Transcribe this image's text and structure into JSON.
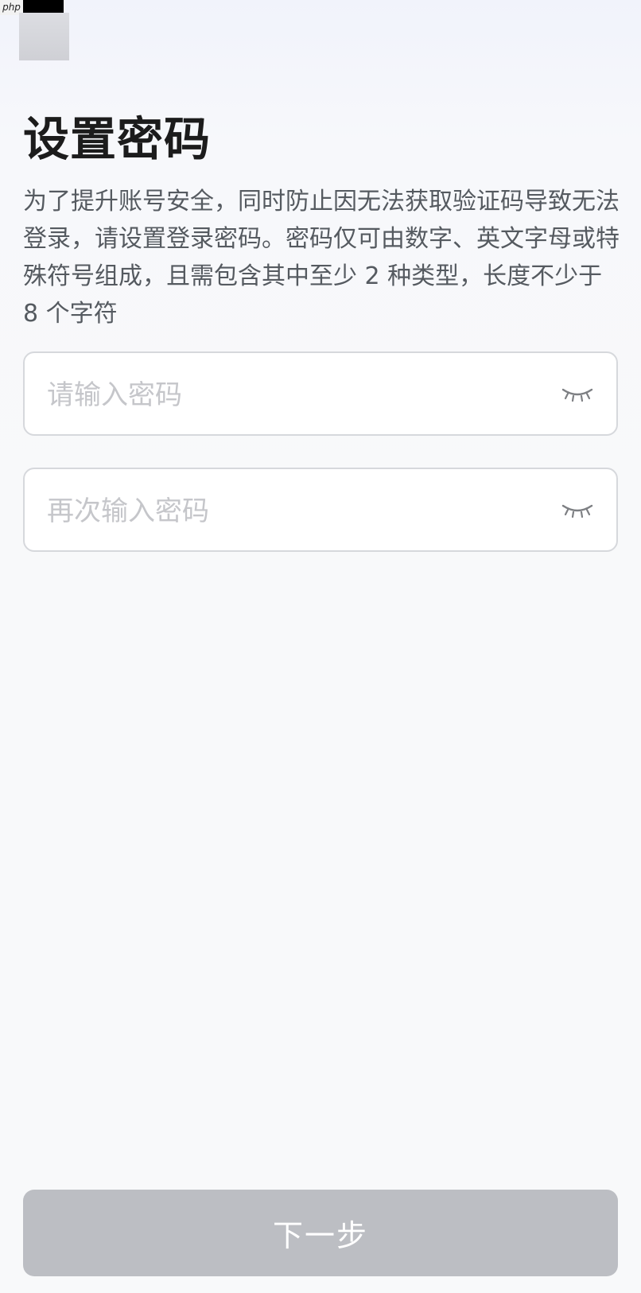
{
  "watermark": {
    "text": "php"
  },
  "header": {
    "title": "设置密码"
  },
  "description": "为了提升账号安全，同时防止因无法获取验证码导致无法登录，请设置登录密码。密码仅可由数字、英文字母或特殊符号组成，且需包含其中至少 2 种类型，长度不少于 8 个字符",
  "form": {
    "password": {
      "placeholder": "请输入密码",
      "value": "",
      "icon": "eye-closed-icon"
    },
    "confirm_password": {
      "placeholder": "再次输入密码",
      "value": "",
      "icon": "eye-closed-icon"
    }
  },
  "footer": {
    "next_label": "下一步"
  },
  "colors": {
    "button_disabled": "#bcbec3",
    "title": "#1c1c1c",
    "description": "#555a60",
    "placeholder": "#c5c6ca",
    "border": "#d6d8dc"
  }
}
